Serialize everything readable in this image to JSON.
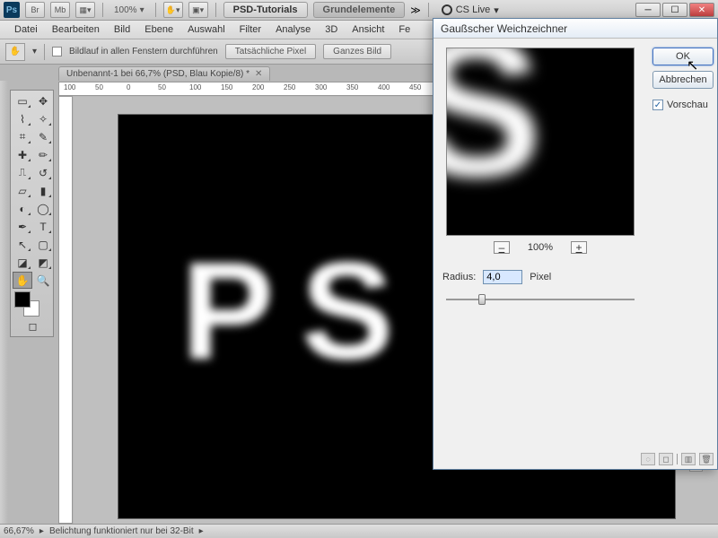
{
  "topbar": {
    "logo": "Ps",
    "br": "Br",
    "mb": "Mb",
    "zoom": "100%",
    "tabs": {
      "a": "PSD-Tutorials",
      "b": "Grundelemente"
    },
    "chev": "≫",
    "cslive": "CS Live"
  },
  "menu": {
    "datei": "Datei",
    "bearbeiten": "Bearbeiten",
    "bild": "Bild",
    "ebene": "Ebene",
    "auswahl": "Auswahl",
    "filter": "Filter",
    "analyse": "Analyse",
    "3d": "3D",
    "ansicht": "Ansicht",
    "fenster": "Fe"
  },
  "options": {
    "scroll_all": "Bildlauf in allen Fenstern durchführen",
    "actual": "Tatsächliche Pixel",
    "fit": "Ganzes Bild"
  },
  "doc": {
    "tab": "Unbenannt-1 bei 66,7% (PSD, Blau Kopie/8) *",
    "canvas_text": "PS"
  },
  "ruler_h": [
    "100",
    "50",
    "0",
    "50",
    "100",
    "150",
    "200",
    "250",
    "300",
    "350",
    "400",
    "450"
  ],
  "status": {
    "zoom": "66,67%",
    "msg": "Belichtung funktioniert nur bei 32-Bit"
  },
  "dialog": {
    "title": "Gaußscher Weichzeichner",
    "zoom": "100%",
    "radius_label": "Radius:",
    "radius_value": "4,0",
    "radius_unit": "Pixel",
    "ok": "OK",
    "cancel": "Abbrechen",
    "preview_chk": "Vorschau",
    "preview_letter": "S"
  }
}
